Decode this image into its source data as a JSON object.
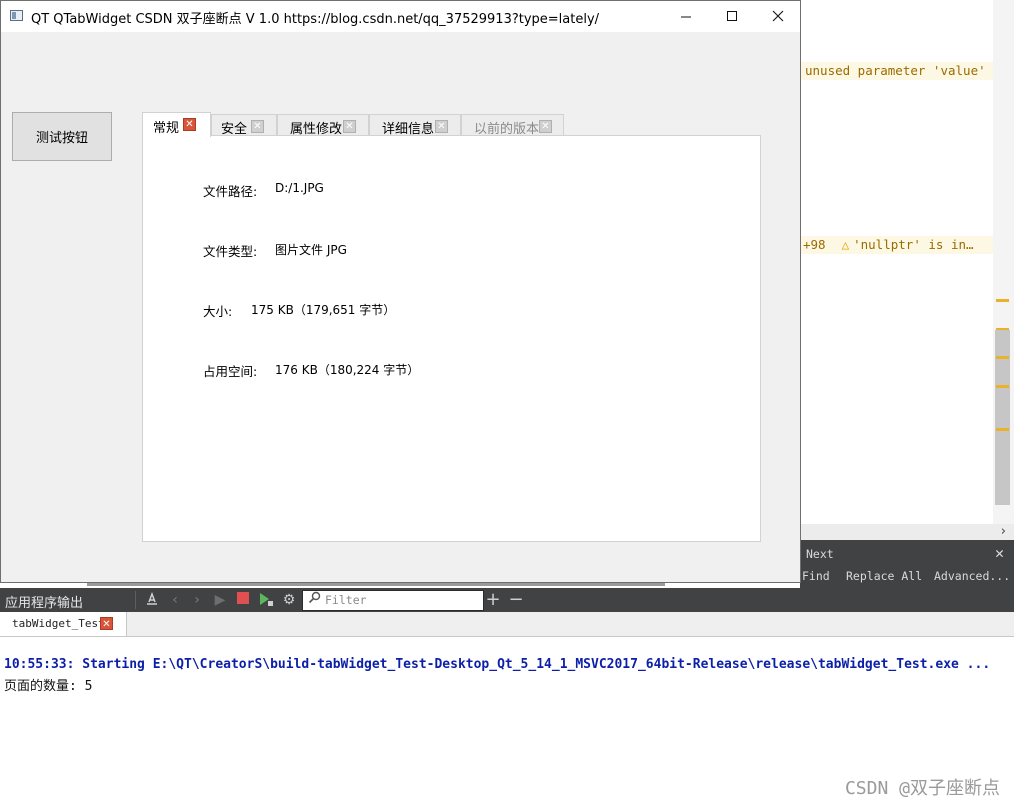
{
  "window": {
    "title": "QT QTabWidget  CSDN 双子座断点 V 1.0 https://blog.csdn.net/qq_37529913?type=lately/",
    "minimize_glyph": "—",
    "maximize_glyph": "☐",
    "close_glyph": "✕"
  },
  "test_button": {
    "label": "测试按钮"
  },
  "tabs": [
    {
      "label": "常规",
      "state": "active",
      "close": "red"
    },
    {
      "label": "安全",
      "state": "normal",
      "close": "grey"
    },
    {
      "label": "属性修改",
      "state": "normal",
      "close": "grey"
    },
    {
      "label": "详细信息",
      "state": "normal",
      "close": "grey"
    },
    {
      "label": "以前的版本",
      "state": "disabled",
      "close": "grey"
    }
  ],
  "general_tab": {
    "file_path_label": "文件路径:",
    "file_path_value": "D:/1.JPG",
    "file_type_label": "文件类型:",
    "file_type_value": "图片文件 JPG",
    "size_label": "大小:",
    "size_value": "175 KB（179,651 字节）",
    "disk_size_label": "占用空间:",
    "disk_size_value": "176 KB（180,224 字节）"
  },
  "editor": {
    "warning1": "unused parameter 'value'",
    "warning2_prefix": "+98",
    "warning2": "'nullptr' is in…",
    "warning_icon": "warning-triangle-icon",
    "warning_color": "#9a6b00",
    "marker_color": "#e9b22b"
  },
  "find_bar": {
    "next_label": "Next",
    "find_label": "Find",
    "replace_all_label": "Replace All",
    "advanced_label": "Advanced..."
  },
  "output_pane": {
    "title": "应用程序输出",
    "filter_placeholder": "Filter",
    "tab_label": "tabWidget_Test",
    "line1": "10:55:33: Starting E:\\QT\\CreatorS\\build-tabWidget_Test-Desktop_Qt_5_14_1_MSVC2017_64bit-Release\\release\\tabWidget_Test.exe ...",
    "line2": "页面的数量: 5",
    "line1_color": "#0b1fa8"
  },
  "watermark": "CSDN @双子座断点"
}
